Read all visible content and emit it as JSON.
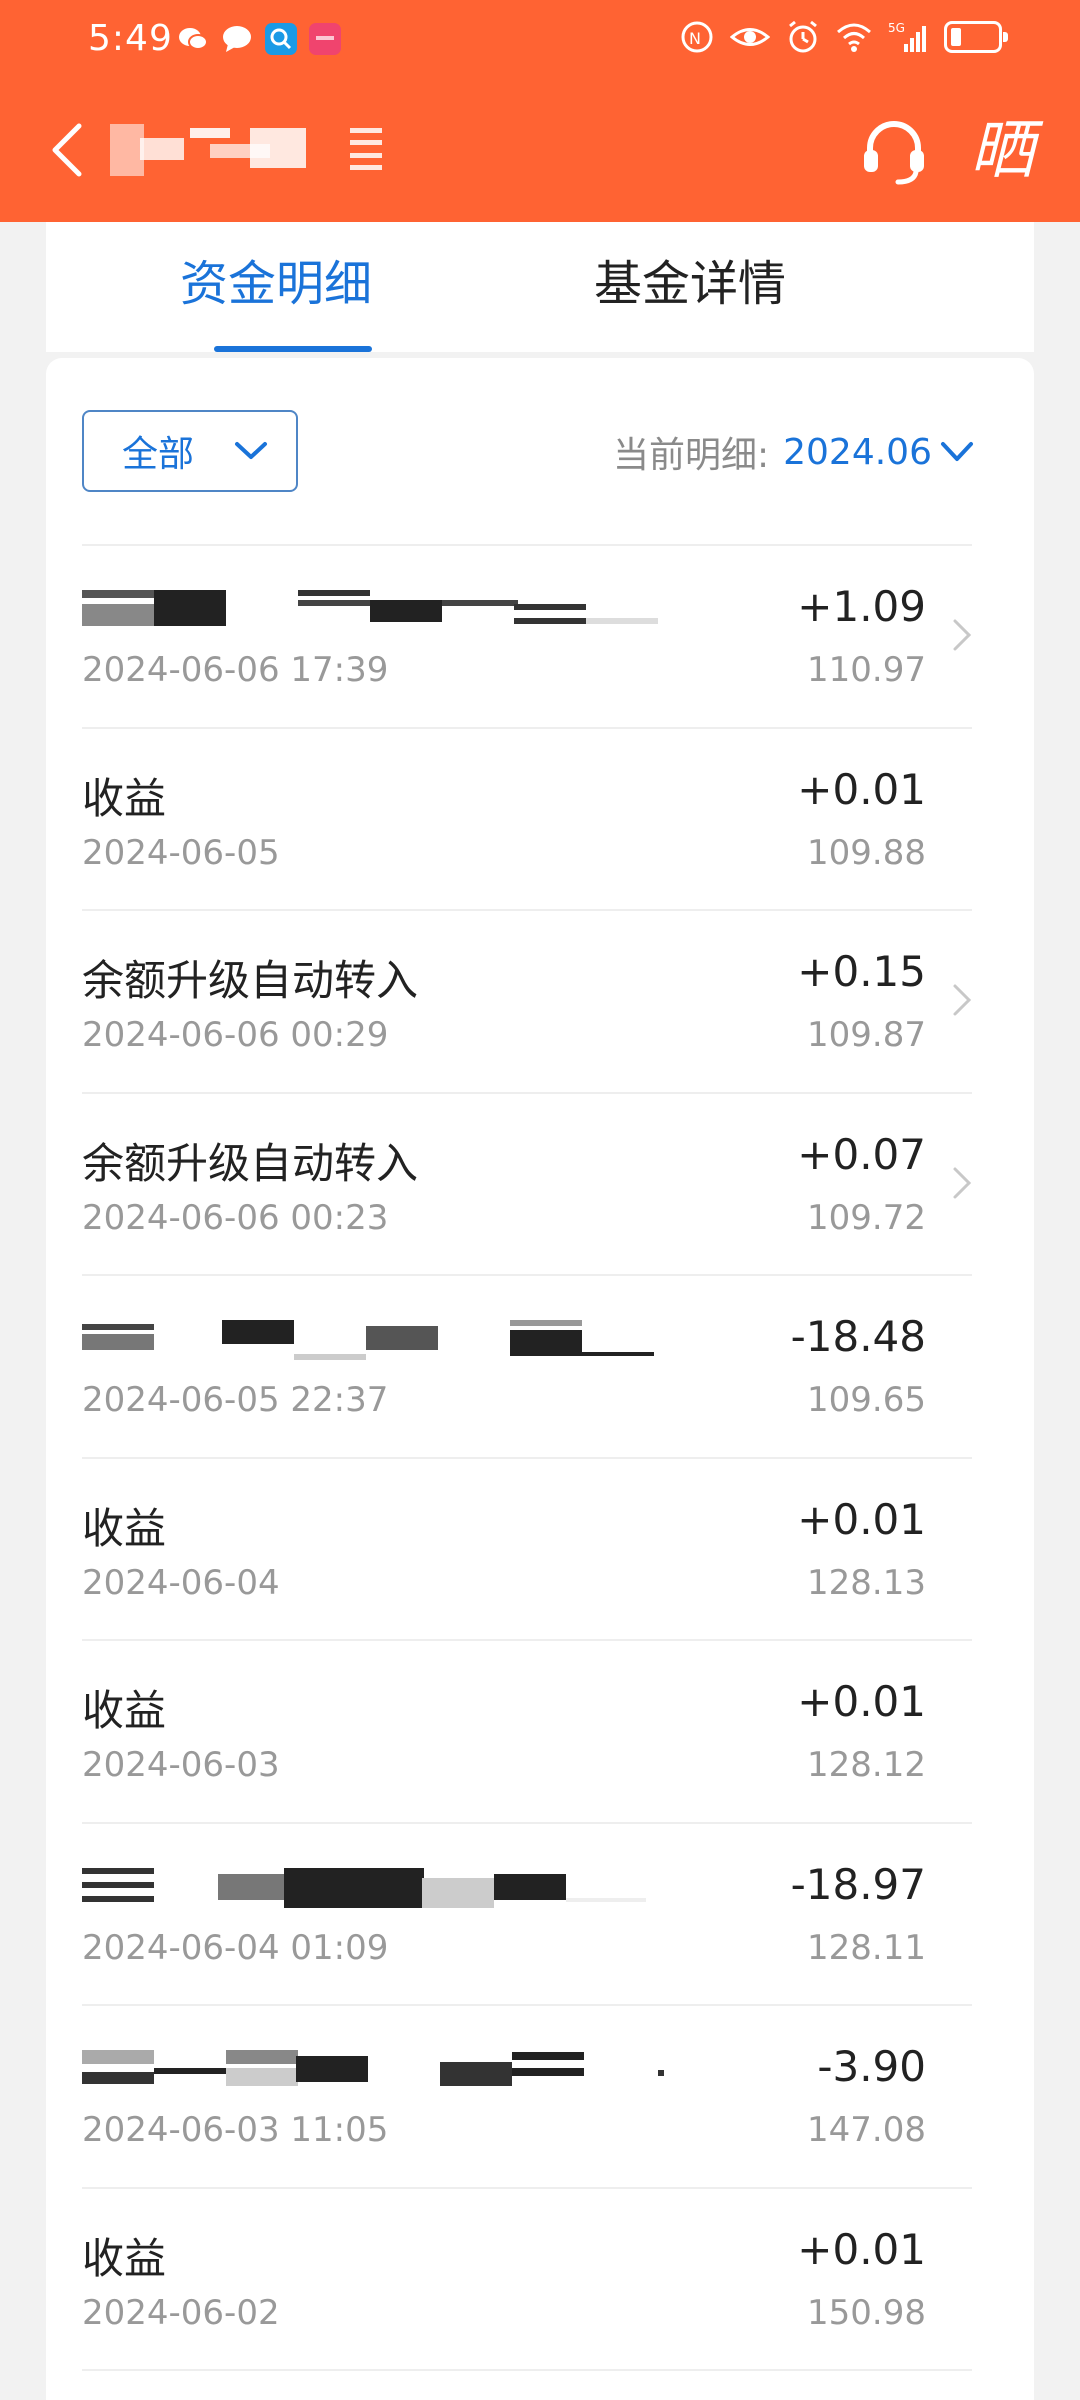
{
  "status_bar": {
    "time": "5:49",
    "left_icons": [
      "wechat-icon",
      "message-icon",
      "search-app-icon",
      "huawei-app-icon"
    ],
    "right_icons": [
      "nfc-icon",
      "eye-comfort-icon",
      "alarm-icon",
      "wifi-icon",
      "signal-5g-icon",
      "battery-icon"
    ],
    "network": "5G"
  },
  "app_bar": {
    "back_icon": "chevron-left-icon",
    "title": "",
    "menu_icon": "menu-lines-icon",
    "support_icon": "headset-icon",
    "share_label": "晒"
  },
  "tabs": [
    {
      "label": "资金明细",
      "active": true
    },
    {
      "label": "基金详情",
      "active": false
    }
  ],
  "filter": {
    "label": "全部",
    "current_period_label": "当前明细:",
    "current_period_value": "2024.06"
  },
  "transactions": [
    {
      "title": "",
      "title_redacted": true,
      "date": "2024-06-06 17:39",
      "amount": "+1.09",
      "balance": "110.97",
      "has_chevron": true
    },
    {
      "title": "收益",
      "title_redacted": false,
      "date": "2024-06-05",
      "amount": "+0.01",
      "balance": "109.88",
      "has_chevron": false
    },
    {
      "title": "余额升级自动转入",
      "title_redacted": false,
      "date": "2024-06-06 00:29",
      "amount": "+0.15",
      "balance": "109.87",
      "has_chevron": true
    },
    {
      "title": "余额升级自动转入",
      "title_redacted": false,
      "date": "2024-06-06 00:23",
      "amount": "+0.07",
      "balance": "109.72",
      "has_chevron": true
    },
    {
      "title": "",
      "title_redacted": true,
      "date": "2024-06-05 22:37",
      "amount": "-18.48",
      "balance": "109.65",
      "has_chevron": false
    },
    {
      "title": "收益",
      "title_redacted": false,
      "date": "2024-06-04",
      "amount": "+0.01",
      "balance": "128.13",
      "has_chevron": false
    },
    {
      "title": "收益",
      "title_redacted": false,
      "date": "2024-06-03",
      "amount": "+0.01",
      "balance": "128.12",
      "has_chevron": false
    },
    {
      "title": "",
      "title_redacted": true,
      "date": "2024-06-04 01:09",
      "amount": "-18.97",
      "balance": "128.11",
      "has_chevron": false
    },
    {
      "title": "",
      "title_redacted": true,
      "date": "2024-06-03 11:05",
      "amount": "-3.90",
      "balance": "147.08",
      "has_chevron": false
    },
    {
      "title": "收益",
      "title_redacted": false,
      "date": "2024-06-02",
      "amount": "+0.01",
      "balance": "150.98",
      "has_chevron": false
    }
  ],
  "colors": {
    "header_bg": "#ff6333",
    "accent_blue": "#1a73d9",
    "text_primary": "#222222",
    "text_secondary": "#999999",
    "page_bg": "#f2f2f2"
  }
}
